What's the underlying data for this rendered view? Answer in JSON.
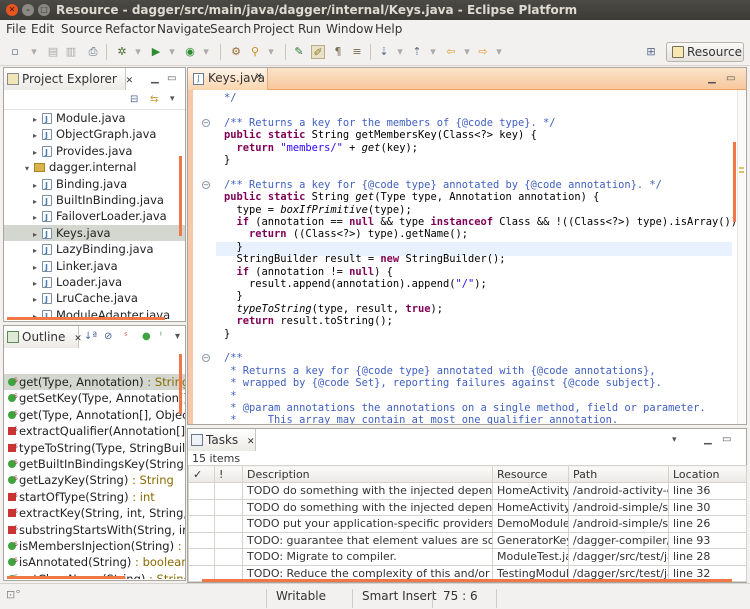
{
  "window": {
    "title": "Resource - dagger/src/main/java/dagger/internal/Keys.java - Eclipse Platform"
  },
  "menu": [
    "File",
    "Edit",
    "Source",
    "Refactor",
    "Navigate",
    "Search",
    "Project",
    "Run",
    "Window",
    "Help"
  ],
  "perspective": {
    "label": "Resource"
  },
  "explorer": {
    "tab_label": "Project Explorer",
    "tab_close": "✕",
    "items": [
      {
        "label": "Module.java",
        "indent": 2,
        "type": "file"
      },
      {
        "label": "ObjectGraph.java",
        "indent": 2,
        "type": "file"
      },
      {
        "label": "Provides.java",
        "indent": 2,
        "type": "file"
      },
      {
        "label": "dagger.internal",
        "indent": 1,
        "type": "package"
      },
      {
        "label": "Binding.java",
        "indent": 2,
        "type": "file"
      },
      {
        "label": "BuiltInBinding.java",
        "indent": 2,
        "type": "file"
      },
      {
        "label": "FailoverLoader.java",
        "indent": 2,
        "type": "file"
      },
      {
        "label": "Keys.java",
        "indent": 2,
        "type": "file",
        "selected": true
      },
      {
        "label": "LazyBinding.java",
        "indent": 2,
        "type": "file"
      },
      {
        "label": "Linker.java",
        "indent": 2,
        "type": "file"
      },
      {
        "label": "Loader.java",
        "indent": 2,
        "type": "file"
      },
      {
        "label": "LruCache.java",
        "indent": 2,
        "type": "file"
      },
      {
        "label": "ModuleAdapter.java",
        "indent": 2,
        "type": "file"
      }
    ]
  },
  "outline": {
    "tab_label": "Outline",
    "tab_close": "✕",
    "items": [
      {
        "name": "get(Type, Annotation)",
        "ret": " : String",
        "vis": "public",
        "selected": true
      },
      {
        "name": "getSetKey(Type, Annotation[]",
        "ret": "",
        "vis": "public"
      },
      {
        "name": "get(Type, Annotation[], Objec",
        "ret": "",
        "vis": "public"
      },
      {
        "name": "extractQualifier(Annotation[]",
        "ret": "",
        "vis": "private"
      },
      {
        "name": "typeToString(Type, StringBuil",
        "ret": "",
        "vis": "private"
      },
      {
        "name": "getBuiltInBindingsKey(String)",
        "ret": "",
        "vis": "public"
      },
      {
        "name": "getLazyKey(String)",
        "ret": " : String",
        "vis": "public"
      },
      {
        "name": "startOfType(String)",
        "ret": " : int",
        "vis": "private"
      },
      {
        "name": "extractKey(String, int, String,",
        "ret": "",
        "vis": "private"
      },
      {
        "name": "substringStartsWith(String, in",
        "ret": "",
        "vis": "private"
      },
      {
        "name": "isMembersInjection(String)",
        "ret": " : l",
        "vis": "public"
      },
      {
        "name": "isAnnotated(String)",
        "ret": " : boolean",
        "vis": "public"
      },
      {
        "name": "getClassName(String)",
        "ret": " : String",
        "vis": "public"
      }
    ]
  },
  "editor": {
    "tab_label": "Keys.java",
    "tab_close": "✕",
    "code": [
      {
        "text": "*/",
        "type": "comment"
      },
      {
        "text": "",
        "type": "blank"
      },
      {
        "text": "/** Returns a key for the members of {@code type}. */",
        "type": "comment",
        "fold": true
      },
      {
        "text": "public static String getMembersKey(Class<?> key) {",
        "type": "code"
      },
      {
        "text": "  return \"members/\" + get(key);",
        "type": "code"
      },
      {
        "text": "}",
        "type": "code"
      },
      {
        "text": "",
        "type": "blank"
      },
      {
        "text": "/** Returns a key for {@code type} annotated by {@code annotation}. */",
        "type": "comment",
        "fold": true
      },
      {
        "text": "public static String get(Type type, Annotation annotation) {",
        "type": "code"
      },
      {
        "text": "  type = boxIfPrimitive(type);",
        "type": "code"
      },
      {
        "text": "  if (annotation == null && type instanceof Class && !((Class<?>) type).isArray()) {",
        "type": "code"
      },
      {
        "text": "    return ((Class<?>) type).getName();",
        "type": "code"
      },
      {
        "text": "  }",
        "type": "code",
        "current": true
      },
      {
        "text": "  StringBuilder result = new StringBuilder();",
        "type": "code"
      },
      {
        "text": "  if (annotation != null) {",
        "type": "code"
      },
      {
        "text": "    result.append(annotation).append(\"/\");",
        "type": "code"
      },
      {
        "text": "  }",
        "type": "code"
      },
      {
        "text": "  typeToString(type, result, true);",
        "type": "code"
      },
      {
        "text": "  return result.toString();",
        "type": "code"
      },
      {
        "text": "}",
        "type": "code"
      },
      {
        "text": "",
        "type": "blank"
      },
      {
        "text": "/**",
        "type": "comment",
        "fold": true
      },
      {
        "text": " * Returns a key for {@code type} annotated with {@code annotations},",
        "type": "comment"
      },
      {
        "text": " * wrapped by {@code Set}, reporting failures against {@code subject}.",
        "type": "comment"
      },
      {
        "text": " *",
        "type": "comment"
      },
      {
        "text": " * @param annotations the annotations on a single method, field or parameter.",
        "type": "comment"
      },
      {
        "text": " *     This array may contain at most one qualifier annotation.",
        "type": "comment"
      }
    ]
  },
  "tasks": {
    "tab_label": "Tasks",
    "tab_close": "✕",
    "count_text": "15 items",
    "columns": [
      "✓",
      "!",
      "Description",
      "Resource",
      "Path",
      "Location"
    ],
    "rows": [
      {
        "description": "TODO do something with the injected dependencies",
        "resource": "HomeActivity.j",
        "path": "/android-activity-gra",
        "location": "line 36"
      },
      {
        "description": "TODO do something with the injected dependencies",
        "resource": "HomeActivity.j",
        "path": "/android-simple/src",
        "location": "line 30"
      },
      {
        "description": "TODO put your application-specific providers here!",
        "resource": "DemoModule.j",
        "path": "/android-simple/src",
        "location": "line 26"
      },
      {
        "description": "TODO: guarantee that element values are sorted by",
        "resource": "GeneratorKeys",
        "path": "/dagger-compiler/src",
        "location": "line 93"
      },
      {
        "description": "TODO: Migrate to compiler.",
        "resource": "ModuleTest.jav",
        "path": "/dagger/src/test/jav",
        "location": "line 28"
      },
      {
        "description": "TODO: Reduce the complexity of this and/or replace",
        "resource": "TestingModule",
        "path": "/dagger/src/test/jav",
        "location": "line 32"
      }
    ]
  },
  "status": {
    "writable": "Writable",
    "insert_mode": "Smart Insert",
    "position": "75 : 6"
  },
  "colors": {
    "accent": "#f07746",
    "selection": "#d3d7cf",
    "keyword": "#7f0055",
    "comment": "#3f5fbf",
    "string": "#2a00ff"
  }
}
